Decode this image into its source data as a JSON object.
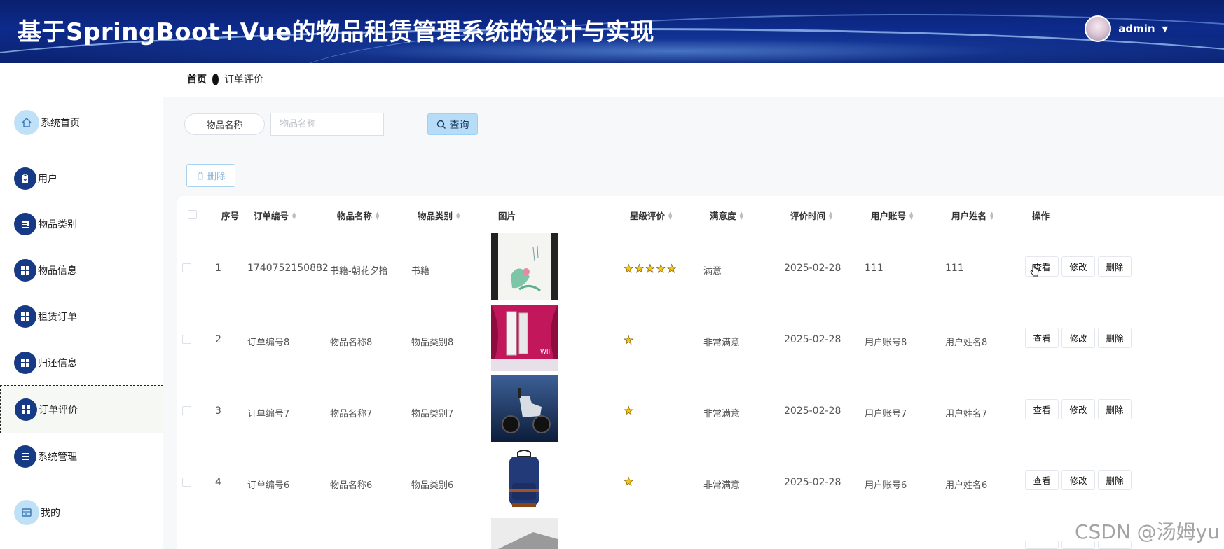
{
  "header": {
    "title": "基于SpringBoot+Vue的物品租赁管理系统的设计与实现",
    "username": "admin",
    "caret": "▼"
  },
  "breadcrumb": {
    "home": "首页",
    "current": "订单评价"
  },
  "sidebar": {
    "items": [
      {
        "label": "系统首页",
        "icon": "home-icon"
      },
      {
        "label": "用户",
        "icon": "clipboard-icon"
      },
      {
        "label": "物品类别",
        "icon": "sliders-icon"
      },
      {
        "label": "物品信息",
        "icon": "grid-icon"
      },
      {
        "label": "租赁订单",
        "icon": "grid-icon"
      },
      {
        "label": "归还信息",
        "icon": "grid-icon"
      },
      {
        "label": "订单评价",
        "icon": "grid-icon"
      },
      {
        "label": "系统管理",
        "icon": "list-icon"
      },
      {
        "label": "我的",
        "icon": "card-icon"
      }
    ],
    "active_index": 6
  },
  "search": {
    "label": "物品名称",
    "placeholder": "物品名称",
    "value": "",
    "query_label": "查询"
  },
  "toolbar": {
    "delete_label": "删除"
  },
  "table": {
    "columns": [
      "序号",
      "订单编号",
      "物品名称",
      "物品类别",
      "图片",
      "星级评价",
      "满意度",
      "评价时间",
      "用户账号",
      "用户姓名",
      "操作"
    ],
    "actions": {
      "view": "查看",
      "edit": "修改",
      "delete": "删除"
    },
    "rows": [
      {
        "index": "1",
        "order_no": "1740752150882",
        "item_name": "书籍-朝花夕拾",
        "category": "书籍",
        "image": "book-cover",
        "stars": 5,
        "satisfaction": "满意",
        "time": "2025-02-28",
        "account": "111",
        "user_name": "111"
      },
      {
        "index": "2",
        "order_no": "订单编号8",
        "item_name": "物品名称8",
        "category": "物品类别8",
        "image": "game-console",
        "stars": 1,
        "satisfaction": "非常满意",
        "time": "2025-02-28",
        "account": "用户账号8",
        "user_name": "用户姓名8"
      },
      {
        "index": "3",
        "order_no": "订单编号7",
        "item_name": "物品名称7",
        "category": "物品类别7",
        "image": "electric-scooter",
        "stars": 1,
        "satisfaction": "非常满意",
        "time": "2025-02-28",
        "account": "用户账号7",
        "user_name": "用户姓名7"
      },
      {
        "index": "4",
        "order_no": "订单编号6",
        "item_name": "物品名称6",
        "category": "物品类别6",
        "image": "backpack",
        "stars": 1,
        "satisfaction": "非常满意",
        "time": "2025-02-28",
        "account": "用户账号6",
        "user_name": "用户姓名6"
      }
    ]
  },
  "watermark": "CSDN @汤姆yu",
  "colors": {
    "header": "#0d2b8c",
    "sidebar_icon": "#163a86",
    "query_button": "#b7dcf8",
    "star": "#f5c518"
  }
}
